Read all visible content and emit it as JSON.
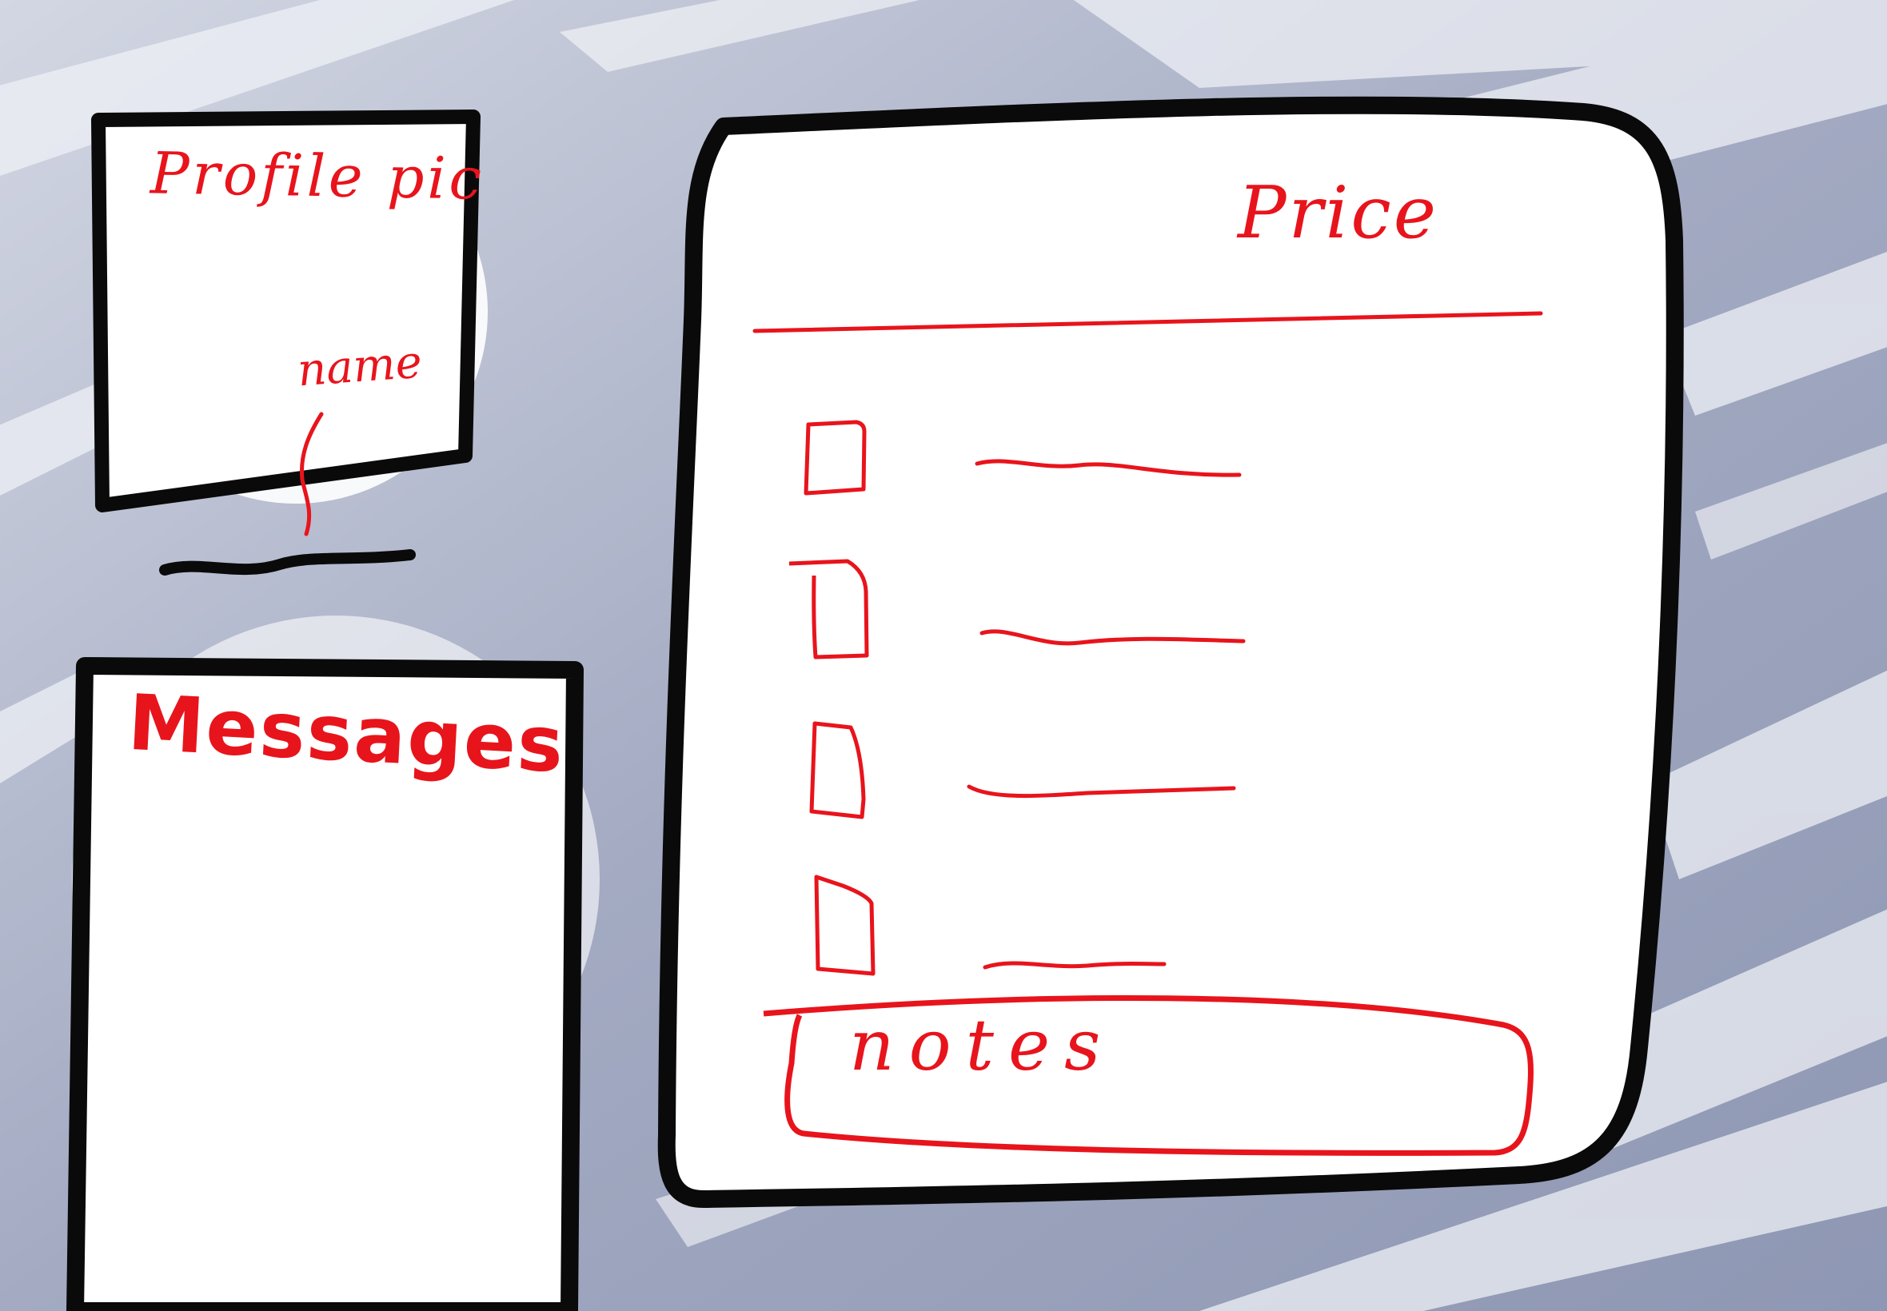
{
  "profile_panel": {
    "label": "Profile pic",
    "name_label": "name"
  },
  "messages_panel": {
    "label": "Messages"
  },
  "price_panel": {
    "title": "Price",
    "items_count": 4,
    "notes_label": "notes"
  },
  "colors": {
    "annotation": "#e8141c",
    "outline": "#0a0a0a",
    "panel": "#ffffff",
    "background": "#a6adc4"
  }
}
